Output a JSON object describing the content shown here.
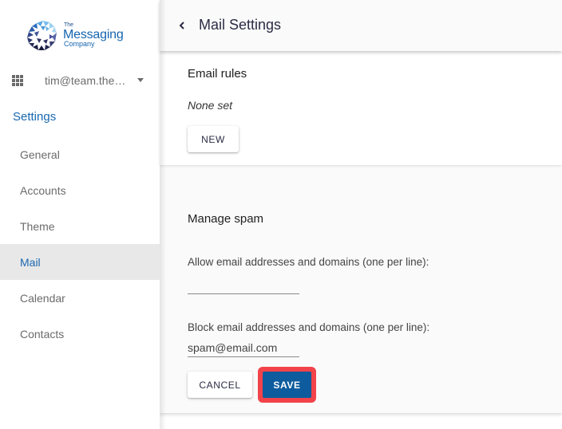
{
  "sidebar": {
    "logo": {
      "line1": "The",
      "line2": "Messaging",
      "line3": "Company"
    },
    "apps_icon": "apps-grid-icon",
    "account_email": "tim@team.the…",
    "account_menu_icon": "caret-down-icon",
    "section_title": "Settings",
    "items": [
      {
        "label": "General",
        "active": false
      },
      {
        "label": "Accounts",
        "active": false
      },
      {
        "label": "Theme",
        "active": false
      },
      {
        "label": "Mail",
        "active": true
      },
      {
        "label": "Calendar",
        "active": false
      },
      {
        "label": "Contacts",
        "active": false
      }
    ]
  },
  "header": {
    "back_icon": "chevron-left-icon",
    "title": "Mail Settings"
  },
  "email_rules": {
    "title": "Email rules",
    "status": "None set",
    "new_label": "NEW"
  },
  "spam": {
    "title": "Manage spam",
    "allow_label": "Allow email addresses and domains (one per line):",
    "allow_value": "",
    "block_label": "Block email addresses and domains (one per line):",
    "block_value": "spam@email.com",
    "cancel_label": "CANCEL",
    "save_label": "SAVE"
  },
  "colors": {
    "accent": "#1a68b0",
    "primary_button": "#0e5c9e",
    "highlight": "#f2434b",
    "active_nav_bg": "#e8e8e8"
  }
}
